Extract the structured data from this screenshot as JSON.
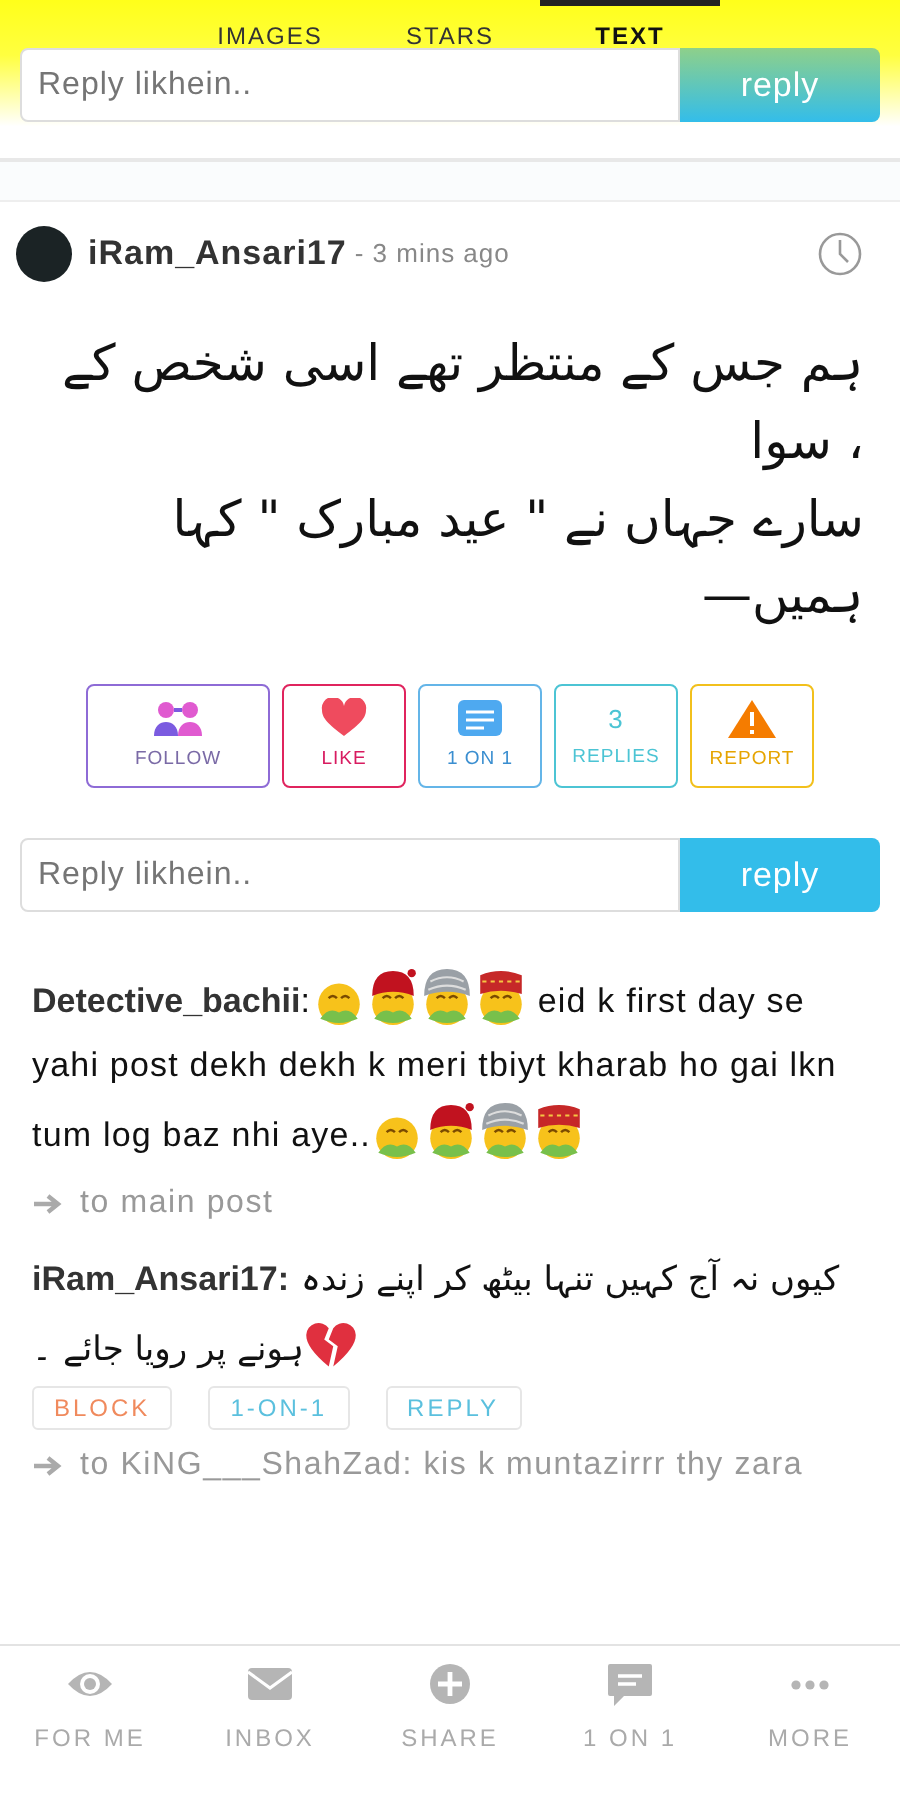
{
  "tabs": [
    {
      "label": "IMAGES",
      "selected": false
    },
    {
      "label": "STARS",
      "selected": false
    },
    {
      "label": "TEXT",
      "selected": true
    }
  ],
  "top_reply": {
    "placeholder": "Reply likhein..",
    "button": "reply"
  },
  "post": {
    "author": "iRam_Ansari17",
    "time": "- 3 mins ago",
    "lines": [
      "ہم جس کے منتظر تھے اسی شخص کے",
      "، سوا",
      "سارے جہاں نے \" عید مبارک \" کہا",
      "ہمیں—"
    ],
    "actions": [
      {
        "kind": "follow",
        "label": "FOLLOW",
        "color": "#8e6bd6"
      },
      {
        "kind": "like",
        "label": "LIKE",
        "color": "#e0245e"
      },
      {
        "kind": "chat",
        "label": "1 ON 1",
        "color": "#64b5e8"
      },
      {
        "kind": "count",
        "count": "3",
        "label": "REPLIES",
        "color": "#4cc4d4"
      },
      {
        "kind": "report",
        "label": "REPORT",
        "color": "#f2c01c"
      }
    ]
  },
  "reply": {
    "placeholder": "Reply likhein..",
    "button": "reply"
  },
  "comments": [
    {
      "author": "Detective_bachii",
      "parts": [
        {
          "kind": "text",
          "text": ":"
        },
        {
          "kind": "sick"
        },
        {
          "kind": "sick-bandana"
        },
        {
          "kind": "sick-turban"
        },
        {
          "kind": "sick-cap"
        },
        {
          "kind": "text",
          "text": " eid k first day se yahi post dekh dekh k meri tbiyt kharab ho gai lkn tum log baz nhi aye.."
        },
        {
          "kind": "sick"
        },
        {
          "kind": "sick-bandana"
        },
        {
          "kind": "sick-turban"
        },
        {
          "kind": "sick-cap"
        }
      ],
      "link": "to main post"
    },
    {
      "author": "iRam_Ansari17:",
      "parts": [
        {
          "kind": "urdu",
          "text": " کیوں نہ آج کہیں تنہا بیٹھ کر اپنے زندہ ہونے پر رویا جائے ۔"
        },
        {
          "kind": "broken-heart"
        }
      ],
      "tags": [
        {
          "label": "BLOCK",
          "color": "#f08a5d"
        },
        {
          "label": "1-ON-1",
          "color": "#5bc0de"
        },
        {
          "label": "REPLY",
          "color": "#5bc0de"
        }
      ],
      "link": "to KiNG___ShahZad: kis k muntazirrr thy zara"
    }
  ],
  "bottom_nav": [
    {
      "kind": "eye",
      "label": "FOR ME"
    },
    {
      "kind": "mail",
      "label": "INBOX"
    },
    {
      "kind": "plus",
      "label": "SHARE"
    },
    {
      "kind": "chat",
      "label": "1 ON 1"
    },
    {
      "kind": "dots",
      "label": "MORE"
    }
  ]
}
